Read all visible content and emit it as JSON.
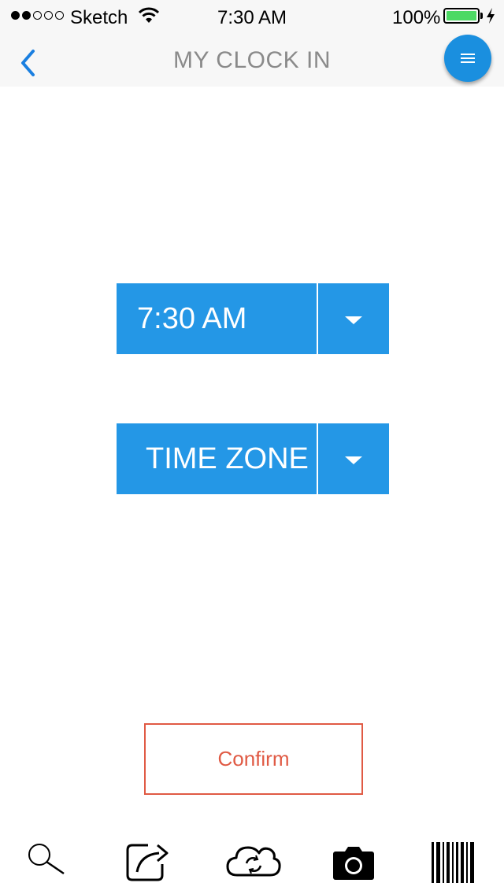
{
  "status_bar": {
    "carrier": "Sketch",
    "time": "7:30 AM",
    "battery": "100%",
    "signal_bars_filled": 2,
    "signal_bars_total": 5,
    "battery_level": 1.0
  },
  "nav": {
    "title": "MY CLOCK IN",
    "back_icon": "chevron-left-icon",
    "menu_icon": "menu-icon"
  },
  "time_dropdown": {
    "value": "7:30 AM"
  },
  "timezone_dropdown": {
    "value": "TIME ZONE"
  },
  "confirm_label": "Confirm",
  "tab_bar": [
    {
      "icon": "search-icon"
    },
    {
      "icon": "share-icon"
    },
    {
      "icon": "cloud-sync-icon"
    },
    {
      "icon": "camera-icon"
    },
    {
      "icon": "barcode-icon"
    }
  ],
  "colors": {
    "accent": "#2497e6",
    "fab": "#1a8fdf",
    "confirm": "#e05a44",
    "back": "#1a7fe0",
    "battery": "#4cd964",
    "title": "#8a8a8a"
  }
}
